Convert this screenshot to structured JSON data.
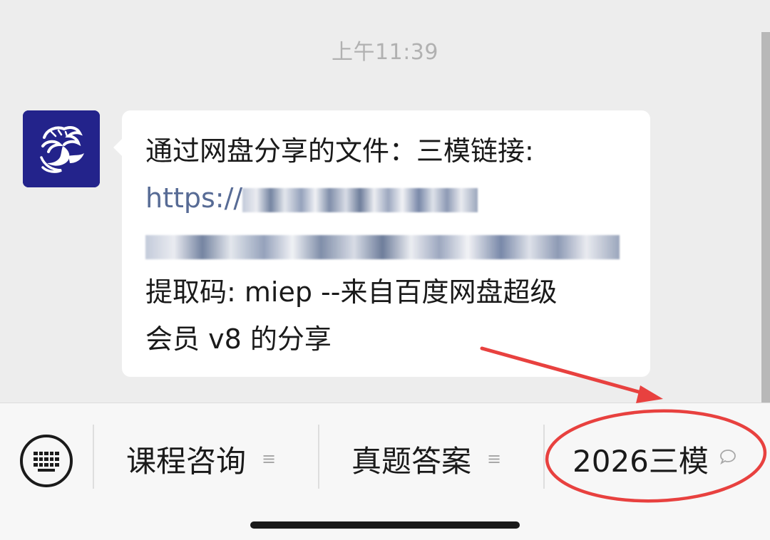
{
  "chat": {
    "timestamp": "上午11:39",
    "message": {
      "line1": "通过网盘分享的文件：三模链接:",
      "link_prefix": "https://",
      "line4": "提取码: miep --来自百度网盘超级",
      "line5": "会员 v8 的分享"
    }
  },
  "bottom_menu": {
    "items": [
      {
        "label": "课程咨询",
        "icon": "menu-lines-icon"
      },
      {
        "label": "真题答案",
        "icon": "menu-lines-icon"
      },
      {
        "label": "2026三模",
        "icon": "speech-bubble-icon"
      }
    ]
  },
  "colors": {
    "background": "#ededed",
    "link": "#576b95",
    "avatar_bg": "#23238b",
    "annotation": "#e8413f"
  }
}
